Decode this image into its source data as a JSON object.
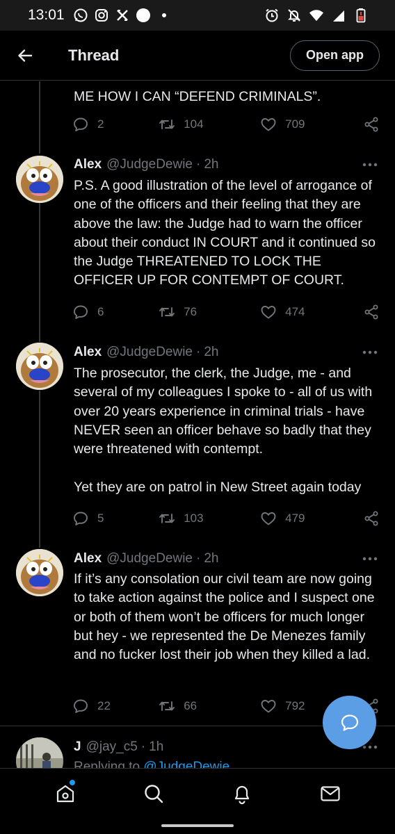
{
  "status_bar": {
    "time": "13:01",
    "left_icons": [
      "whatsapp-icon",
      "instagram-icon",
      "x-icon",
      "circle-icon",
      "dot-icon"
    ],
    "right_icons": [
      "alarm-icon",
      "mute-icon",
      "wifi-icon",
      "signal-icon",
      "battery-icon"
    ]
  },
  "header": {
    "title": "Thread",
    "open_app_label": "Open app"
  },
  "tweets": [
    {
      "partial": true,
      "text": "ME HOW I CAN “DEFEND CRIMINALS”.",
      "reply_count": "2",
      "retweet_count": "104",
      "like_count": "709"
    },
    {
      "name": "Alex",
      "handle": "@JudgeDewie",
      "dot": "·",
      "time": "2h",
      "text": "P.S. A good illustration of the level of arrogance of one of the officers and their feeling that they are above the law: the Judge had to warn the officer about their conduct IN COURT and it continued so the Judge THREATENED TO LOCK THE OFFICER UP FOR CONTEMPT OF COURT.",
      "reply_count": "6",
      "retweet_count": "76",
      "like_count": "474"
    },
    {
      "name": "Alex",
      "handle": "@JudgeDewie",
      "dot": "·",
      "time": "2h",
      "text": "The prosecutor, the clerk, the Judge, me - and several of my colleagues I spoke to - all of us with over 20 years experience in criminal trials - have NEVER seen an officer behave so badly that they were threatened with contempt.\n\nYet they are on patrol in New Street again today",
      "reply_count": "5",
      "retweet_count": "103",
      "like_count": "479"
    },
    {
      "name": "Alex",
      "handle": "@JudgeDewie",
      "dot": "·",
      "time": "2h",
      "text": "If it’s any consolation our civil team are now going to take action against the police and I suspect one or both of them won’t be officers for much longer but hey - we represented the De Menezes family and no fucker lost their job when they killed a lad.",
      "reply_count": "22",
      "retweet_count": "66",
      "like_count": "792"
    },
    {
      "name": "J",
      "handle": "@jay_c5",
      "dot": "·",
      "time": "1h",
      "replying_prefix": "Replying to ",
      "replying_to": "@JudgeDewie"
    }
  ],
  "bottom_nav": {
    "items": [
      "home-icon",
      "search-icon",
      "notifications-icon",
      "messages-icon"
    ],
    "home_has_badge": true
  },
  "colors": {
    "background": "#000000",
    "text": "#e7e9ea",
    "muted": "#71767b",
    "accent": "#1d9bf0",
    "fab": "#5b9ee6",
    "divider": "#2f3336"
  }
}
